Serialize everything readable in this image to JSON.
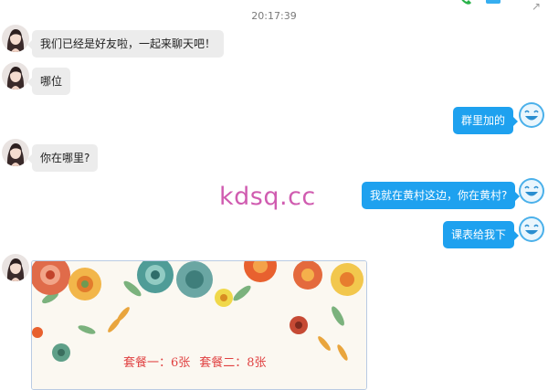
{
  "chat": {
    "timestamp": "20:17:39",
    "watermark": "kdsq.cc",
    "messages": [
      {
        "side": "left",
        "text": "我们已经是好友啦，一起来聊天吧！"
      },
      {
        "side": "left",
        "text": "哪位"
      },
      {
        "side": "right",
        "text": "群里加的"
      },
      {
        "side": "left",
        "text": "你在哪里?"
      },
      {
        "side": "right",
        "text": "我就在黄村这边，你在黄村?"
      },
      {
        "side": "right",
        "text": "课表给我下"
      }
    ],
    "image_message": {
      "package_one": "套餐一：6张",
      "package_two": "套餐二：8张"
    }
  },
  "colors": {
    "outgoing_bubble": "#1ea1ef",
    "incoming_bubble": "#ececec",
    "watermark": "#d05cb0",
    "card_text": "#e04141"
  },
  "icons": {
    "contact_avatar": "girl-portrait-avatar",
    "self_avatar": "smiley-face-icon",
    "expand": "expand-arrow-icon",
    "call": "phone-icon",
    "video": "video-camera-icon"
  }
}
